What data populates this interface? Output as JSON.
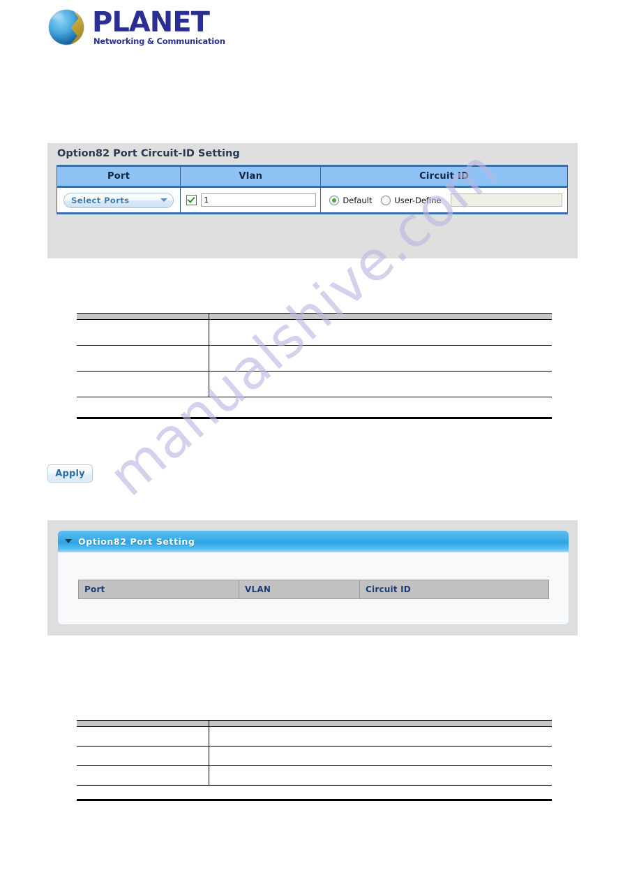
{
  "brand": {
    "name": "PLANET",
    "tagline": "Networking & Communication",
    "logo_icon": "planet-globe-logo",
    "text_color": "#2b2f8f"
  },
  "watermark": {
    "text": "manualshive.com",
    "color": "#b9b6e0"
  },
  "circuit_id_panel": {
    "title": "Option82 Port Circuit-ID Setting",
    "columns": [
      "Port",
      "Vlan",
      "Circuit ID"
    ],
    "port": {
      "select_label": "Select Ports",
      "dropdown_icon": "chevron-down-icon"
    },
    "vlan": {
      "checkbox_checked": true,
      "value": "1",
      "placeholder": ""
    },
    "circuit_id": {
      "options": [
        "Default",
        "User-Define"
      ],
      "selected": "Default",
      "user_define_value": "",
      "user_define_placeholder": "",
      "user_define_enabled": false
    },
    "apply_label": "Apply",
    "header_bg": "#8fc2f5",
    "header_border": "#3b6fa5"
  },
  "apply_standalone": {
    "label": "Apply"
  },
  "port_setting_panel": {
    "title": "Option82 Port Setting",
    "collapse_icon": "triangle-down-icon",
    "columns": [
      "Port",
      "VLAN",
      "Circuit ID"
    ],
    "rows": [],
    "header_gradient_start": "#5fbdef",
    "header_gradient_end": "#8fd4f6"
  },
  "doc_table_1": {
    "headers": [
      "",
      ""
    ],
    "rows": [
      [
        "",
        ""
      ],
      [
        "",
        ""
      ],
      [
        "",
        ""
      ]
    ]
  },
  "doc_table_2": {
    "headers": [
      "",
      ""
    ],
    "rows": [
      [
        "",
        ""
      ],
      [
        "",
        ""
      ],
      [
        "",
        ""
      ]
    ]
  }
}
